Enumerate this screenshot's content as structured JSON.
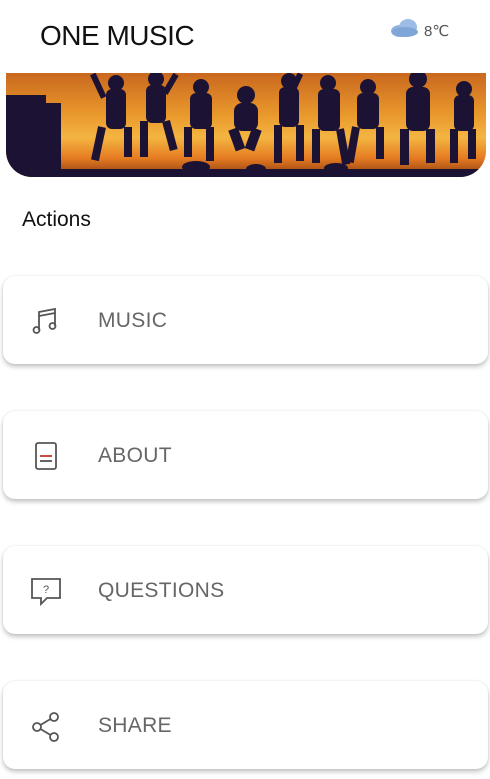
{
  "header": {
    "app_title": "ONE MUSIC",
    "weather": {
      "icon": "cloud-icon",
      "temperature": "8℃"
    }
  },
  "banner": {
    "image": "crowd-jumping-at-sunset-photo"
  },
  "actions": {
    "title": "Actions",
    "items": [
      {
        "label": "MUSIC",
        "icon": "music-note-icon"
      },
      {
        "label": "ABOUT",
        "icon": "document-icon"
      },
      {
        "label": "QUESTIONS",
        "icon": "question-bubble-icon"
      },
      {
        "label": "SHARE",
        "icon": "share-icon"
      }
    ]
  },
  "colors": {
    "background": "#ffffff",
    "label": "#666666",
    "title": "#111111",
    "weather_cloud": "#8fb3df"
  }
}
